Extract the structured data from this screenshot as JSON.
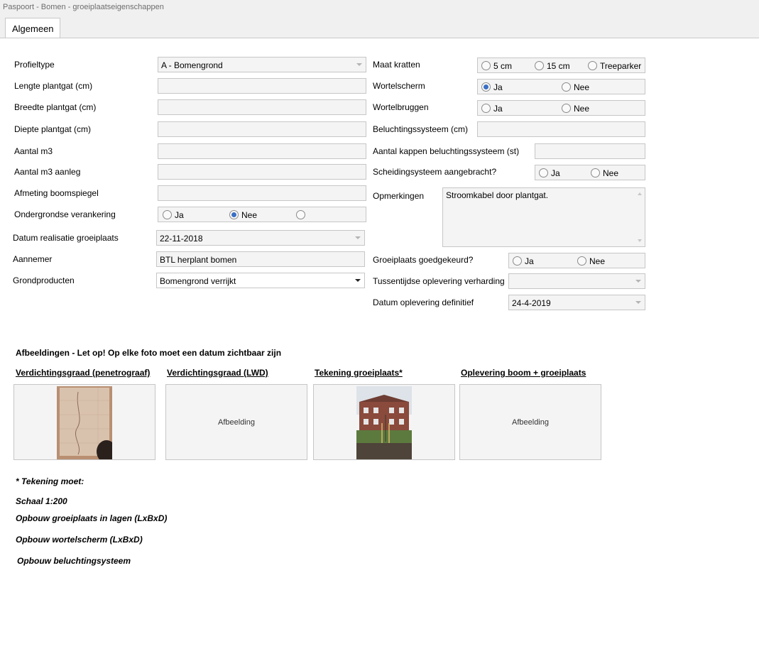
{
  "window": {
    "title": "Paspoort - Bomen - groeiplaatseigenschappen"
  },
  "tabs": [
    {
      "label": "Algemeen"
    }
  ],
  "left": {
    "profieltype": {
      "label": "Profieltype",
      "value": "A - Bomengrond"
    },
    "lengte": {
      "label": "Lengte plantgat (cm)",
      "value": ""
    },
    "breedte": {
      "label": "Breedte plantgat (cm)",
      "value": ""
    },
    "diepte": {
      "label": "Diepte plantgat (cm)",
      "value": ""
    },
    "aantal_m3": {
      "label": "Aantal m3",
      "value": ""
    },
    "aantal_m3_aanleg": {
      "label": "Aantal m3 aanleg",
      "value": ""
    },
    "afmeting": {
      "label": "Afmeting boomspiegel",
      "value": ""
    },
    "verankering": {
      "label": "Ondergrondse verankering",
      "options": [
        "Ja",
        "Nee",
        ""
      ],
      "selected": "Nee"
    },
    "datum_realisatie": {
      "label": "Datum realisatie groeiplaats",
      "value": "22-11-2018"
    },
    "aannemer": {
      "label": "Aannemer",
      "value": "BTL herplant bomen"
    },
    "grondproducten": {
      "label": "Grondproducten",
      "value": "Bomengrond verrijkt"
    }
  },
  "right": {
    "maat_kratten": {
      "label": "Maat kratten",
      "options": [
        "5 cm",
        "15 cm",
        "Treeparker"
      ],
      "selected": ""
    },
    "wortelscherm": {
      "label": "Wortelscherm",
      "options": [
        "Ja",
        "Nee"
      ],
      "selected": "Ja"
    },
    "wortelbruggen": {
      "label": "Wortelbruggen",
      "options": [
        "Ja",
        "Nee"
      ],
      "selected": ""
    },
    "beluchting": {
      "label": "Beluchtingssysteem (cm)",
      "value": ""
    },
    "kappen": {
      "label": "Aantal kappen beluchtingssysteem (st)",
      "value": ""
    },
    "scheiding": {
      "label": "Scheidingsysteem aangebracht?",
      "options": [
        "Ja",
        "Nee"
      ],
      "selected": ""
    },
    "opmerkingen": {
      "label": "Opmerkingen",
      "value": "Stroomkabel door plantgat."
    },
    "goedgekeurd": {
      "label": "Groeiplaats goedgekeurd?",
      "options": [
        "Ja",
        "Nee"
      ],
      "selected": ""
    },
    "tussentijdse": {
      "label": "Tussentijdse oplevering verharding",
      "value": ""
    },
    "definitief": {
      "label": "Datum oplevering definitief",
      "value": "24-4-2019"
    }
  },
  "images": {
    "section_title": "Afbeeldingen - Let op! Op elke foto moet een datum zichtbaar zijn",
    "items": [
      {
        "label": "Verdichtingsgraad (penetrograaf)",
        "placeholder": ""
      },
      {
        "label": "Verdichtingsgraad (LWD)",
        "placeholder": "Afbeelding"
      },
      {
        "label": "Tekening groeiplaats*",
        "placeholder": ""
      },
      {
        "label": "Oplevering boom + groeiplaats",
        "placeholder": "Afbeelding"
      }
    ]
  },
  "notes": [
    "* Tekening moet:",
    "Schaal 1:200",
    "Opbouw groeiplaats in lagen (LxBxD)",
    "Opbouw wortelscherm (LxBxD)",
    "Opbouw beluchtingsysteem"
  ]
}
